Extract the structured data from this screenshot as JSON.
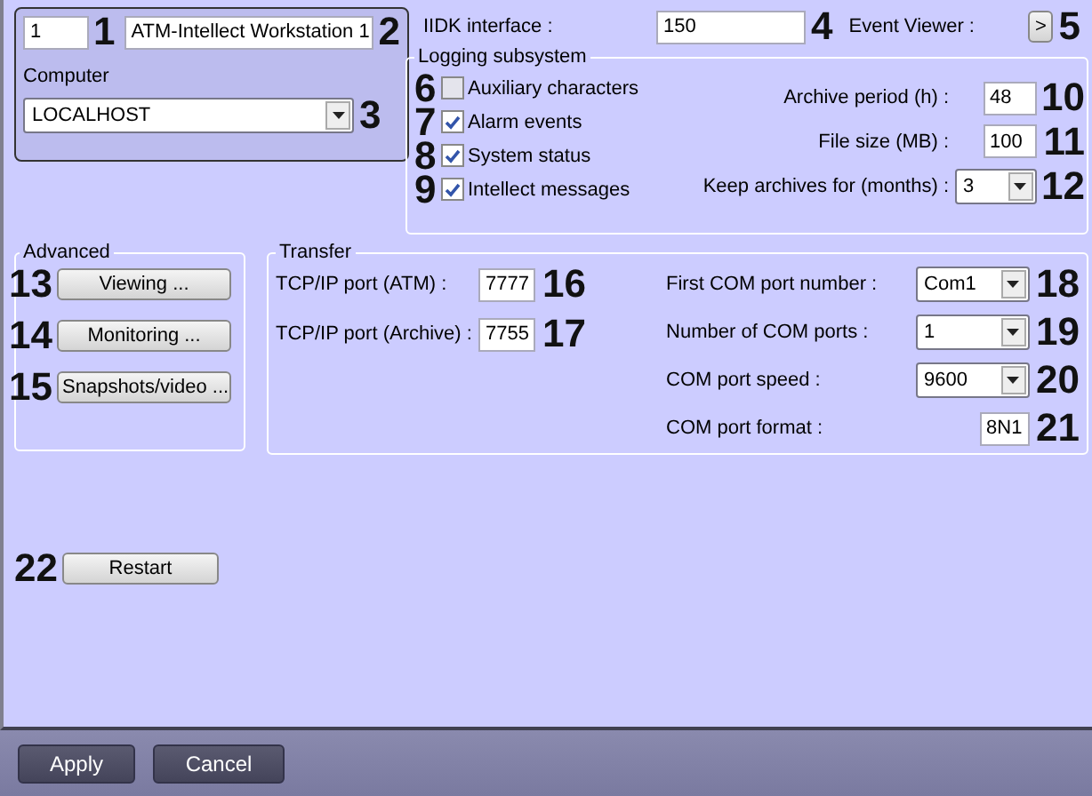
{
  "header": {
    "id_field": {
      "value": "1",
      "callout": "1"
    },
    "name_field": {
      "value": "ATM-Intellect Workstation 1",
      "callout": "2"
    },
    "computer": {
      "label": "Computer",
      "value": "LOCALHOST",
      "callout": "3"
    }
  },
  "iidk": {
    "label": "IIDK interface :",
    "value": "150",
    "callout": "4"
  },
  "event_viewer": {
    "label": "Event Viewer :",
    "button": ">",
    "callout": "5"
  },
  "logging": {
    "title": "Logging subsystem",
    "checkboxes": [
      {
        "label": "Auxiliary characters",
        "checked": false,
        "callout": "6"
      },
      {
        "label": "Alarm events",
        "checked": true,
        "callout": "7"
      },
      {
        "label": "System status",
        "checked": true,
        "callout": "8"
      },
      {
        "label": "Intellect messages",
        "checked": true,
        "callout": "9"
      }
    ],
    "fields": [
      {
        "kind": "input",
        "label": "Archive period (h) :",
        "value": "48",
        "callout": "10"
      },
      {
        "kind": "input",
        "label": "File size (MB) :",
        "value": "100",
        "callout": "11"
      },
      {
        "kind": "combo",
        "label": "Keep archives for (months) :",
        "value": "3",
        "callout": "12"
      }
    ]
  },
  "advanced": {
    "title": "Advanced",
    "buttons": [
      {
        "label": "Viewing ...",
        "callout": "13"
      },
      {
        "label": "Monitoring ...",
        "callout": "14"
      },
      {
        "label": "Snapshots/video ...",
        "callout": "15"
      }
    ]
  },
  "transfer": {
    "title": "Transfer",
    "ports": [
      {
        "label": "TCP/IP port (ATM) :",
        "value": "7777",
        "callout": "16"
      },
      {
        "label": "TCP/IP port (Archive) :",
        "value": "7755",
        "callout": "17"
      }
    ],
    "com": [
      {
        "kind": "combo",
        "label": "First COM port number :",
        "value": "Com1",
        "callout": "18"
      },
      {
        "kind": "combo",
        "label": "Number of COM ports :",
        "value": "1",
        "callout": "19"
      },
      {
        "kind": "combo",
        "label": "COM port speed :",
        "value": "9600",
        "callout": "20"
      },
      {
        "kind": "input",
        "label": "COM port format :",
        "value": "8N1",
        "callout": "21"
      }
    ]
  },
  "restart": {
    "label": "Restart",
    "callout": "22"
  },
  "footer": {
    "buttons": [
      "Apply",
      "Cancel"
    ]
  }
}
